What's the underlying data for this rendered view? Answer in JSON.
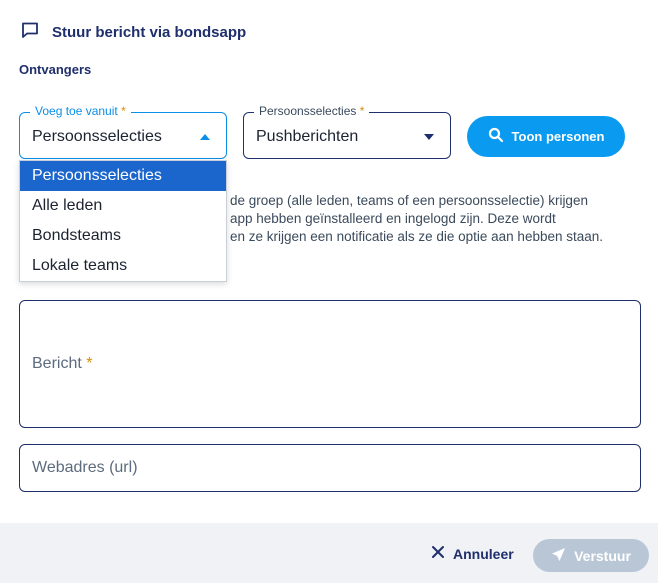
{
  "header": {
    "title": "Stuur bericht via bondsapp",
    "icon": "message-square-icon"
  },
  "recipients": {
    "section_label": "Ontvangers",
    "from_select": {
      "label": "Voeg toe vanuit",
      "required_mark": "*",
      "value": "Persoonsselecties"
    },
    "selection_select": {
      "label": "Persoonsselecties",
      "required_mark": "*",
      "value": "Pushberichten"
    },
    "show_button": {
      "label": "Toon personen",
      "icon": "search-icon"
    },
    "dropdown_options": [
      "Persoonsselecties",
      "Alle leden",
      "Bondsteams",
      "Lokale teams"
    ],
    "info_lines": [
      "de groep (alle leden, teams of een persoonsselectie) krijgen",
      "app hebben geïnstalleerd en ingelogd zijn. Deze wordt",
      "en ze krijgen een notificatie als ze die optie aan hebben staan."
    ]
  },
  "message": {
    "placeholder": "Bericht",
    "required_mark": "*"
  },
  "url": {
    "placeholder": "Webadres (url)"
  },
  "footer": {
    "cancel_label": "Annuleer",
    "send_label": "Verstuur"
  },
  "colors": {
    "primary": "#0a9bf0",
    "navy": "#1f2f6b",
    "selected": "#1a66cc",
    "disabled": "#b9c6d6",
    "required": "#d98c00"
  }
}
